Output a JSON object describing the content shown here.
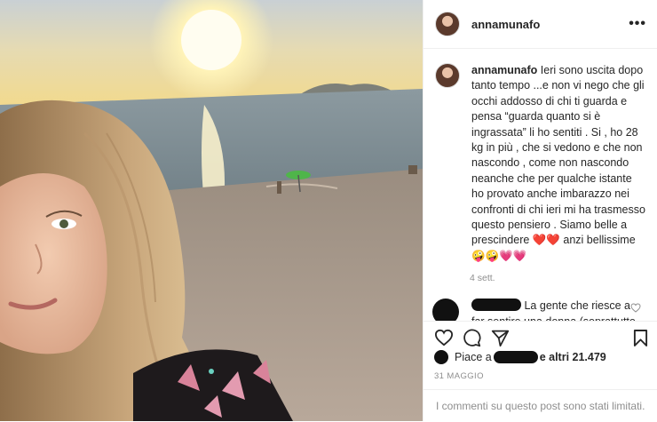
{
  "post": {
    "username": "annamunafo",
    "more_glyph": "•••",
    "caption": "Ieri sono uscita dopo tanto tempo ...e non vi nego che gli occhi addosso di chi ti guarda e pensa “guarda quanto si è ingrassata” li ho sentiti . Si , ho 28 kg in più , che si vedono e che non nascondo , come non nascondo neanche che per qualche istante ho provato anche imbarazzo nei confronti di chi ieri mi ha trasmesso questo pensiero . Siamo belle a prescindere ❤️❤️ anzi bellissime 🤪🤪💗💗",
    "caption_age": "4 sett.",
    "comment": {
      "text": "La gente che riesce a far sentire una donna (soprattutto dopo una gravidanza ) inadeguata, solo"
    },
    "likes": {
      "prefix": "Piace a",
      "suffix": "e altri 21.479"
    },
    "date": "31 MAGGIO",
    "comments_limited": "I commenti su questo post sono stati limitati."
  },
  "icons": {
    "more": "more-options-icon",
    "like": "heart-icon",
    "comment": "comment-icon",
    "share": "share-icon",
    "save": "bookmark-icon",
    "comment_like": "small-heart-icon"
  }
}
